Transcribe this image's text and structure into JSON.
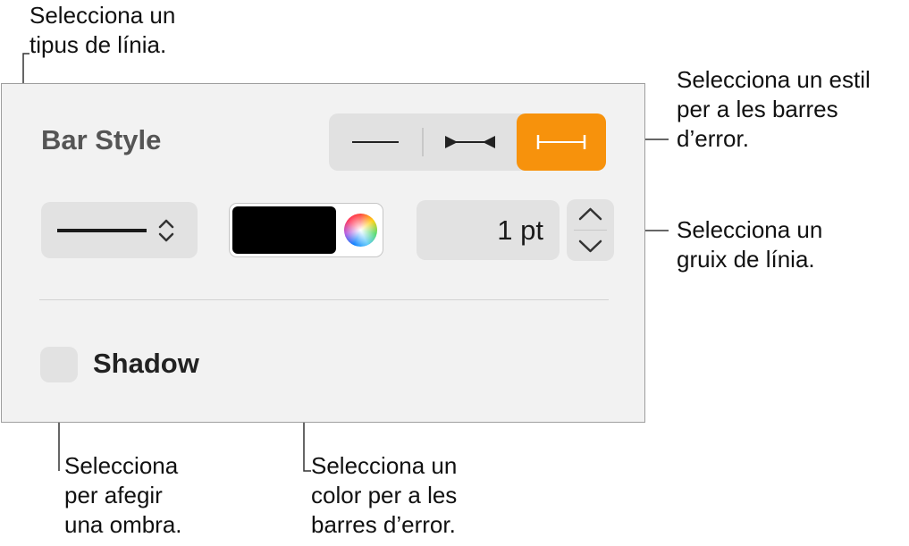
{
  "panel": {
    "title": "Bar Style",
    "bar_style_options": [
      {
        "icon": "line-no-caps-icon",
        "selected": false
      },
      {
        "icon": "line-arrow-caps-icon",
        "selected": false
      },
      {
        "icon": "line-bar-caps-icon",
        "selected": true
      }
    ],
    "line_type": {
      "icon": "solid-line-icon"
    },
    "color": {
      "value": "#000000"
    },
    "stroke_width": "1 pt",
    "shadow": {
      "label": "Shadow",
      "checked": false
    }
  },
  "callouts": {
    "line_type": [
      "Selecciona un",
      "tipus de línia."
    ],
    "bar_style": [
      "Selecciona un estil",
      "per a les barres",
      "d’error."
    ],
    "line_width": [
      "Selecciona un",
      "gruix de línia."
    ],
    "shadow": [
      "Selecciona",
      "per afegir",
      "una ombra."
    ],
    "color": [
      "Selecciona un",
      "color per a les",
      "barres d’error."
    ]
  },
  "colors": {
    "accent": "#f7920c",
    "panel_bg": "#f2f2f2",
    "control_bg": "#e2e2e2"
  }
}
